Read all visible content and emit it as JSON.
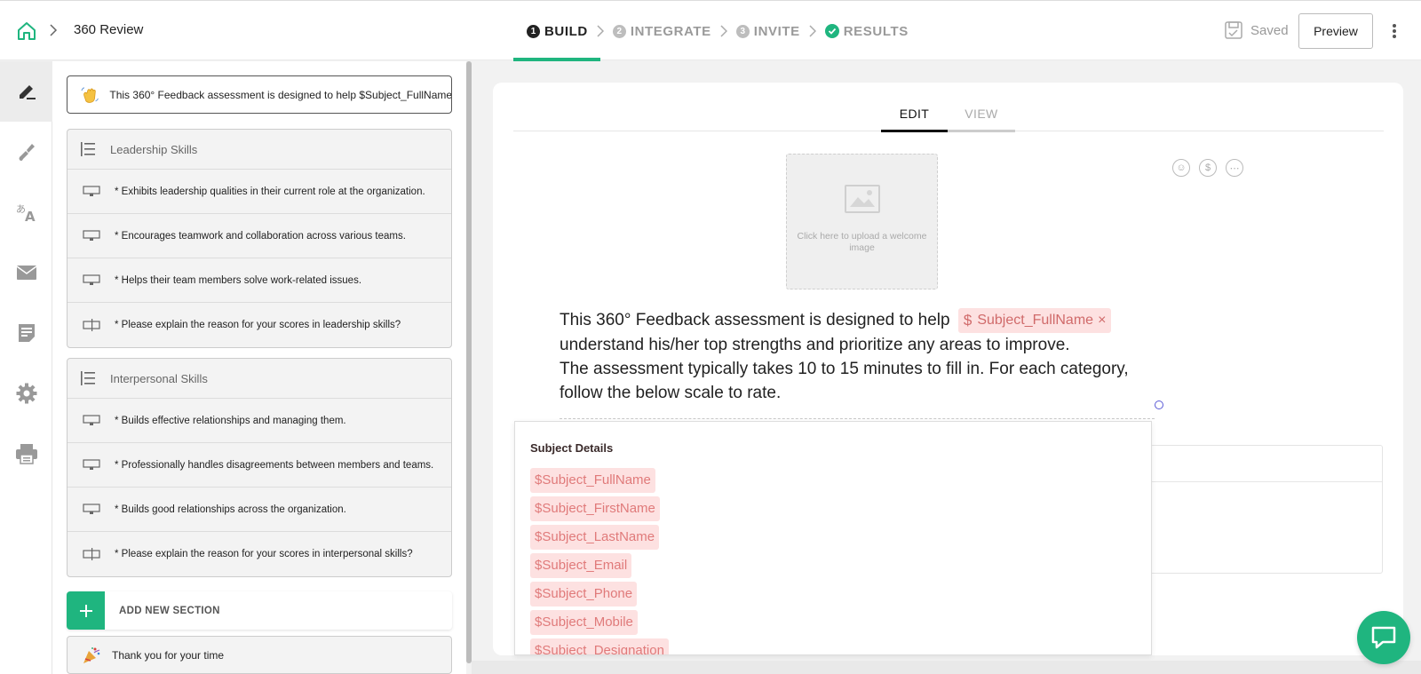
{
  "breadcrumb": {
    "title": "360 Review"
  },
  "steps": [
    {
      "num": "1",
      "label": "BUILD"
    },
    {
      "num": "2",
      "label": "INTEGRATE"
    },
    {
      "num": "3",
      "label": "INVITE"
    },
    {
      "label": "RESULTS"
    }
  ],
  "header": {
    "saved_label": "Saved",
    "preview_label": "Preview"
  },
  "rail": [
    "edit-icon",
    "paint-brush-icon",
    "translate-icon",
    "mail-icon",
    "report-icon",
    "gear-icon",
    "print-icon"
  ],
  "welcome_card": {
    "text": "This 360° Feedback assessment is designed to help $Subject_FullName..."
  },
  "sections": [
    {
      "title": "Leadership Skills",
      "questions": [
        "* Exhibits leadership qualities in their current role at the organization.",
        "* Encourages teamwork and collaboration across various teams.",
        "* Helps their team members solve work-related issues.",
        "* Please explain the reason for your scores in leadership skills?"
      ]
    },
    {
      "title": "Interpersonal Skills",
      "questions": [
        "* Builds effective relationships and managing them.",
        "* Professionally handles disagreements between members and teams.",
        "* Builds good relationships across the organization.",
        "* Please explain the reason for your scores in interpersonal skills?"
      ]
    }
  ],
  "add_section_label": "ADD NEW SECTION",
  "thank_you_card": {
    "text": "Thank you for your time"
  },
  "editor": {
    "tabs": {
      "edit": "EDIT",
      "view": "VIEW"
    },
    "image_hint": "Click here to upload a welcome image",
    "text_part1": "This 360° Feedback assessment is designed to help",
    "chip": {
      "dollar": "$",
      "label": "Subject_FullName",
      "remove": "×"
    },
    "text_part2": "understand his/her top strengths and prioritize any areas to improve.",
    "text_part3": "The assessment typically takes 10 to 15 minutes to fill in. For each category, follow the below scale to rate."
  },
  "dropdown": {
    "title": "Subject Details",
    "items": [
      "$Subject_FullName",
      "$Subject_FirstName",
      "$Subject_LastName",
      "$Subject_Email",
      "$Subject_Phone",
      "$Subject_Mobile",
      "$Subject_Designation"
    ]
  },
  "colors": {
    "accent": "#1fb57f",
    "chip_bg": "#fde1e1",
    "chip_text": "#e07a7a"
  }
}
